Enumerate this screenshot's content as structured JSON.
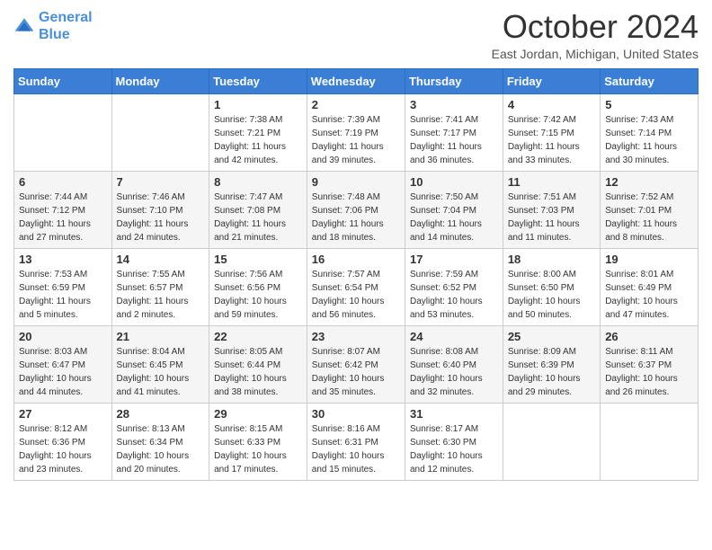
{
  "header": {
    "logo_line1": "General",
    "logo_line2": "Blue",
    "month": "October 2024",
    "location": "East Jordan, Michigan, United States"
  },
  "days_of_week": [
    "Sunday",
    "Monday",
    "Tuesday",
    "Wednesday",
    "Thursday",
    "Friday",
    "Saturday"
  ],
  "weeks": [
    [
      {
        "day": "",
        "sunrise": "",
        "sunset": "",
        "daylight": ""
      },
      {
        "day": "",
        "sunrise": "",
        "sunset": "",
        "daylight": ""
      },
      {
        "day": "1",
        "sunrise": "Sunrise: 7:38 AM",
        "sunset": "Sunset: 7:21 PM",
        "daylight": "Daylight: 11 hours and 42 minutes."
      },
      {
        "day": "2",
        "sunrise": "Sunrise: 7:39 AM",
        "sunset": "Sunset: 7:19 PM",
        "daylight": "Daylight: 11 hours and 39 minutes."
      },
      {
        "day": "3",
        "sunrise": "Sunrise: 7:41 AM",
        "sunset": "Sunset: 7:17 PM",
        "daylight": "Daylight: 11 hours and 36 minutes."
      },
      {
        "day": "4",
        "sunrise": "Sunrise: 7:42 AM",
        "sunset": "Sunset: 7:15 PM",
        "daylight": "Daylight: 11 hours and 33 minutes."
      },
      {
        "day": "5",
        "sunrise": "Sunrise: 7:43 AM",
        "sunset": "Sunset: 7:14 PM",
        "daylight": "Daylight: 11 hours and 30 minutes."
      }
    ],
    [
      {
        "day": "6",
        "sunrise": "Sunrise: 7:44 AM",
        "sunset": "Sunset: 7:12 PM",
        "daylight": "Daylight: 11 hours and 27 minutes."
      },
      {
        "day": "7",
        "sunrise": "Sunrise: 7:46 AM",
        "sunset": "Sunset: 7:10 PM",
        "daylight": "Daylight: 11 hours and 24 minutes."
      },
      {
        "day": "8",
        "sunrise": "Sunrise: 7:47 AM",
        "sunset": "Sunset: 7:08 PM",
        "daylight": "Daylight: 11 hours and 21 minutes."
      },
      {
        "day": "9",
        "sunrise": "Sunrise: 7:48 AM",
        "sunset": "Sunset: 7:06 PM",
        "daylight": "Daylight: 11 hours and 18 minutes."
      },
      {
        "day": "10",
        "sunrise": "Sunrise: 7:50 AM",
        "sunset": "Sunset: 7:04 PM",
        "daylight": "Daylight: 11 hours and 14 minutes."
      },
      {
        "day": "11",
        "sunrise": "Sunrise: 7:51 AM",
        "sunset": "Sunset: 7:03 PM",
        "daylight": "Daylight: 11 hours and 11 minutes."
      },
      {
        "day": "12",
        "sunrise": "Sunrise: 7:52 AM",
        "sunset": "Sunset: 7:01 PM",
        "daylight": "Daylight: 11 hours and 8 minutes."
      }
    ],
    [
      {
        "day": "13",
        "sunrise": "Sunrise: 7:53 AM",
        "sunset": "Sunset: 6:59 PM",
        "daylight": "Daylight: 11 hours and 5 minutes."
      },
      {
        "day": "14",
        "sunrise": "Sunrise: 7:55 AM",
        "sunset": "Sunset: 6:57 PM",
        "daylight": "Daylight: 11 hours and 2 minutes."
      },
      {
        "day": "15",
        "sunrise": "Sunrise: 7:56 AM",
        "sunset": "Sunset: 6:56 PM",
        "daylight": "Daylight: 10 hours and 59 minutes."
      },
      {
        "day": "16",
        "sunrise": "Sunrise: 7:57 AM",
        "sunset": "Sunset: 6:54 PM",
        "daylight": "Daylight: 10 hours and 56 minutes."
      },
      {
        "day": "17",
        "sunrise": "Sunrise: 7:59 AM",
        "sunset": "Sunset: 6:52 PM",
        "daylight": "Daylight: 10 hours and 53 minutes."
      },
      {
        "day": "18",
        "sunrise": "Sunrise: 8:00 AM",
        "sunset": "Sunset: 6:50 PM",
        "daylight": "Daylight: 10 hours and 50 minutes."
      },
      {
        "day": "19",
        "sunrise": "Sunrise: 8:01 AM",
        "sunset": "Sunset: 6:49 PM",
        "daylight": "Daylight: 10 hours and 47 minutes."
      }
    ],
    [
      {
        "day": "20",
        "sunrise": "Sunrise: 8:03 AM",
        "sunset": "Sunset: 6:47 PM",
        "daylight": "Daylight: 10 hours and 44 minutes."
      },
      {
        "day": "21",
        "sunrise": "Sunrise: 8:04 AM",
        "sunset": "Sunset: 6:45 PM",
        "daylight": "Daylight: 10 hours and 41 minutes."
      },
      {
        "day": "22",
        "sunrise": "Sunrise: 8:05 AM",
        "sunset": "Sunset: 6:44 PM",
        "daylight": "Daylight: 10 hours and 38 minutes."
      },
      {
        "day": "23",
        "sunrise": "Sunrise: 8:07 AM",
        "sunset": "Sunset: 6:42 PM",
        "daylight": "Daylight: 10 hours and 35 minutes."
      },
      {
        "day": "24",
        "sunrise": "Sunrise: 8:08 AM",
        "sunset": "Sunset: 6:40 PM",
        "daylight": "Daylight: 10 hours and 32 minutes."
      },
      {
        "day": "25",
        "sunrise": "Sunrise: 8:09 AM",
        "sunset": "Sunset: 6:39 PM",
        "daylight": "Daylight: 10 hours and 29 minutes."
      },
      {
        "day": "26",
        "sunrise": "Sunrise: 8:11 AM",
        "sunset": "Sunset: 6:37 PM",
        "daylight": "Daylight: 10 hours and 26 minutes."
      }
    ],
    [
      {
        "day": "27",
        "sunrise": "Sunrise: 8:12 AM",
        "sunset": "Sunset: 6:36 PM",
        "daylight": "Daylight: 10 hours and 23 minutes."
      },
      {
        "day": "28",
        "sunrise": "Sunrise: 8:13 AM",
        "sunset": "Sunset: 6:34 PM",
        "daylight": "Daylight: 10 hours and 20 minutes."
      },
      {
        "day": "29",
        "sunrise": "Sunrise: 8:15 AM",
        "sunset": "Sunset: 6:33 PM",
        "daylight": "Daylight: 10 hours and 17 minutes."
      },
      {
        "day": "30",
        "sunrise": "Sunrise: 8:16 AM",
        "sunset": "Sunset: 6:31 PM",
        "daylight": "Daylight: 10 hours and 15 minutes."
      },
      {
        "day": "31",
        "sunrise": "Sunrise: 8:17 AM",
        "sunset": "Sunset: 6:30 PM",
        "daylight": "Daylight: 10 hours and 12 minutes."
      },
      {
        "day": "",
        "sunrise": "",
        "sunset": "",
        "daylight": ""
      },
      {
        "day": "",
        "sunrise": "",
        "sunset": "",
        "daylight": ""
      }
    ]
  ]
}
